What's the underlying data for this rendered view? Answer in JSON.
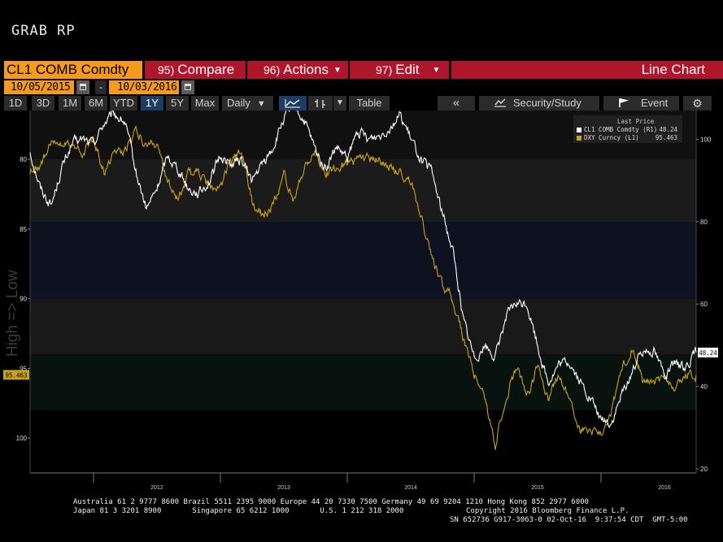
{
  "page_title": "GRAB RP",
  "toolbar": {
    "ticker_value": "CL1 COMB Comdty",
    "compare_num": "95)",
    "compare_label": "Compare",
    "actions_num": "96)",
    "actions_label": "Actions",
    "edit_num": "97)",
    "edit_label": "Edit",
    "chart_type_label": "Line Chart"
  },
  "date_range": {
    "start": "10/05/2015",
    "separator": "-",
    "end": "10/03/2016"
  },
  "period_buttons": [
    "1D",
    "3D",
    "1M",
    "6M",
    "YTD",
    "1Y",
    "5Y",
    "Max"
  ],
  "selected_period": "1Y",
  "frequency": "Daily",
  "table_label": "Table",
  "nav_back_label": "«",
  "security_study_label": "Security/Study",
  "event_label": "Event",
  "colors": {
    "crude": "#ffffff",
    "dxy": "#c8a21a",
    "accent": "#f59a1a",
    "redbar": "#b0162b"
  },
  "chart_data": {
    "type": "line",
    "xlabel": "",
    "left_ylabel": "High => Low",
    "x_tick_labels": [
      "2012",
      "2013",
      "2014",
      "2015",
      "2016"
    ],
    "xlim": [
      "2011-07",
      "2016-10"
    ],
    "left_axis": {
      "inverted": true,
      "ticks": [
        80,
        85,
        90,
        95,
        100
      ],
      "ylim": [
        76.5,
        102.5
      ]
    },
    "right_axis": {
      "ticks": [
        20,
        40,
        60,
        80,
        100
      ],
      "ylim": [
        19,
        107
      ]
    },
    "bands": [
      [
        80,
        84.5
      ],
      [
        84.5,
        90
      ],
      [
        90,
        94
      ],
      [
        94,
        98
      ]
    ],
    "legend": {
      "header": "Last Price",
      "entries": [
        {
          "label": "CL1 COMB Comdty",
          "axis": "(R1)",
          "value": "48.24"
        },
        {
          "label": "DXY Curncy",
          "axis": "(L1)",
          "value": "95.463"
        }
      ]
    },
    "last_value_tags": {
      "left": "95.463",
      "right": "48.24"
    },
    "series": [
      {
        "name": "CL1 COMB Comdty",
        "axis": "right",
        "points": [
          [
            "2011-07",
            97
          ],
          [
            "2011-08",
            88
          ],
          [
            "2011-09",
            84
          ],
          [
            "2011-10",
            93
          ],
          [
            "2011-11",
            99
          ],
          [
            "2011-12",
            100
          ],
          [
            "2012-01",
            99
          ],
          [
            "2012-02",
            104
          ],
          [
            "2012-03",
            106
          ],
          [
            "2012-04",
            104
          ],
          [
            "2012-05",
            92
          ],
          [
            "2012-06",
            83
          ],
          [
            "2012-07",
            88
          ],
          [
            "2012-08",
            96
          ],
          [
            "2012-09",
            93
          ],
          [
            "2012-10",
            88
          ],
          [
            "2012-11",
            87
          ],
          [
            "2012-12",
            90
          ],
          [
            "2013-01",
            96
          ],
          [
            "2013-02",
            94
          ],
          [
            "2013-03",
            95
          ],
          [
            "2013-04",
            90
          ],
          [
            "2013-05",
            94
          ],
          [
            "2013-06",
            98
          ],
          [
            "2013-07",
            105
          ],
          [
            "2013-08",
            108
          ],
          [
            "2013-09",
            104
          ],
          [
            "2013-10",
            97
          ],
          [
            "2013-11",
            93
          ],
          [
            "2013-12",
            98
          ],
          [
            "2014-01",
            95
          ],
          [
            "2014-02",
            102
          ],
          [
            "2014-03",
            100
          ],
          [
            "2014-04",
            101
          ],
          [
            "2014-05",
            103
          ],
          [
            "2014-06",
            106
          ],
          [
            "2014-07",
            100
          ],
          [
            "2014-08",
            95
          ],
          [
            "2014-09",
            92
          ],
          [
            "2014-10",
            82
          ],
          [
            "2014-11",
            73
          ],
          [
            "2014-12",
            56
          ],
          [
            "2015-01",
            47
          ],
          [
            "2015-02",
            50
          ],
          [
            "2015-03",
            47
          ],
          [
            "2015-04",
            57
          ],
          [
            "2015-05",
            60
          ],
          [
            "2015-06",
            60
          ],
          [
            "2015-07",
            50
          ],
          [
            "2015-08",
            41
          ],
          [
            "2015-09",
            45
          ],
          [
            "2015-10",
            46
          ],
          [
            "2015-11",
            41
          ],
          [
            "2015-12",
            37
          ],
          [
            "2016-01",
            32
          ],
          [
            "2016-02",
            31
          ],
          [
            "2016-03",
            38
          ],
          [
            "2016-04",
            44
          ],
          [
            "2016-05",
            49
          ],
          [
            "2016-06",
            49
          ],
          [
            "2016-07",
            43
          ],
          [
            "2016-08",
            45
          ],
          [
            "2016-09",
            45
          ],
          [
            "2016-10",
            48.24
          ]
        ]
      },
      {
        "name": "DXY Curncy",
        "axis": "left",
        "points": [
          [
            "2011-07",
            81
          ],
          [
            "2011-08",
            80.5
          ],
          [
            "2011-09",
            78.5
          ],
          [
            "2011-10",
            79
          ],
          [
            "2011-11",
            79
          ],
          [
            "2011-12",
            79.5
          ],
          [
            "2012-01",
            78.5
          ],
          [
            "2012-02",
            81
          ],
          [
            "2012-03",
            79.5
          ],
          [
            "2012-04",
            79.5
          ],
          [
            "2012-05",
            78
          ],
          [
            "2012-06",
            79
          ],
          [
            "2012-07",
            79
          ],
          [
            "2012-08",
            81.5
          ],
          [
            "2012-09",
            83
          ],
          [
            "2012-10",
            81
          ],
          [
            "2012-11",
            81
          ],
          [
            "2012-12",
            82
          ],
          [
            "2013-01",
            82
          ],
          [
            "2013-02",
            80
          ],
          [
            "2013-03",
            79.5
          ],
          [
            "2013-04",
            83
          ],
          [
            "2013-05",
            84
          ],
          [
            "2013-06",
            83.5
          ],
          [
            "2013-07",
            81
          ],
          [
            "2013-08",
            83
          ],
          [
            "2013-09",
            80.5
          ],
          [
            "2013-10",
            79.5
          ],
          [
            "2013-11",
            81
          ],
          [
            "2013-12",
            80.5
          ],
          [
            "2014-01",
            80.5
          ],
          [
            "2014-02",
            80
          ],
          [
            "2014-03",
            80
          ],
          [
            "2014-04",
            80
          ],
          [
            "2014-05",
            80.5
          ],
          [
            "2014-06",
            81
          ],
          [
            "2014-07",
            81.5
          ],
          [
            "2014-08",
            84
          ],
          [
            "2014-09",
            87
          ],
          [
            "2014-10",
            89
          ],
          [
            "2014-11",
            90
          ],
          [
            "2014-12",
            93
          ],
          [
            "2015-01",
            95.5
          ],
          [
            "2015-02",
            97
          ],
          [
            "2015-03",
            100.5
          ],
          [
            "2015-04",
            97
          ],
          [
            "2015-05",
            95
          ],
          [
            "2015-06",
            97
          ],
          [
            "2015-07",
            95
          ],
          [
            "2015-08",
            97
          ],
          [
            "2015-09",
            95.5
          ],
          [
            "2015-10",
            97
          ],
          [
            "2015-11",
            99.5
          ],
          [
            "2015-12",
            99.5
          ],
          [
            "2016-01",
            99.5
          ],
          [
            "2016-02",
            98
          ],
          [
            "2016-03",
            95
          ],
          [
            "2016-04",
            93.5
          ],
          [
            "2016-05",
            96
          ],
          [
            "2016-06",
            96
          ],
          [
            "2016-07",
            95.5
          ],
          [
            "2016-08",
            96.5
          ],
          [
            "2016-09",
            95.5
          ],
          [
            "2016-10",
            95.463
          ]
        ]
      }
    ]
  },
  "footer": {
    "line1": "Australia 61 2 9777 8600 Brazil 5511 2395 9000 Europe 44 20 7330 7500 Germany 49 69 9204 1210 Hong Kong 852 2977 6000",
    "line2a": "Japan 81 3 3201 8900       Singapore 65 6212 1000       U.S. 1 212 318 2000",
    "line2b": "Copyright 2016 Bloomberg Finance L.P.",
    "line3": "SN 652736 G917-3063-0 02-Oct-16  9:37:54 CDT  GMT-5:00"
  }
}
